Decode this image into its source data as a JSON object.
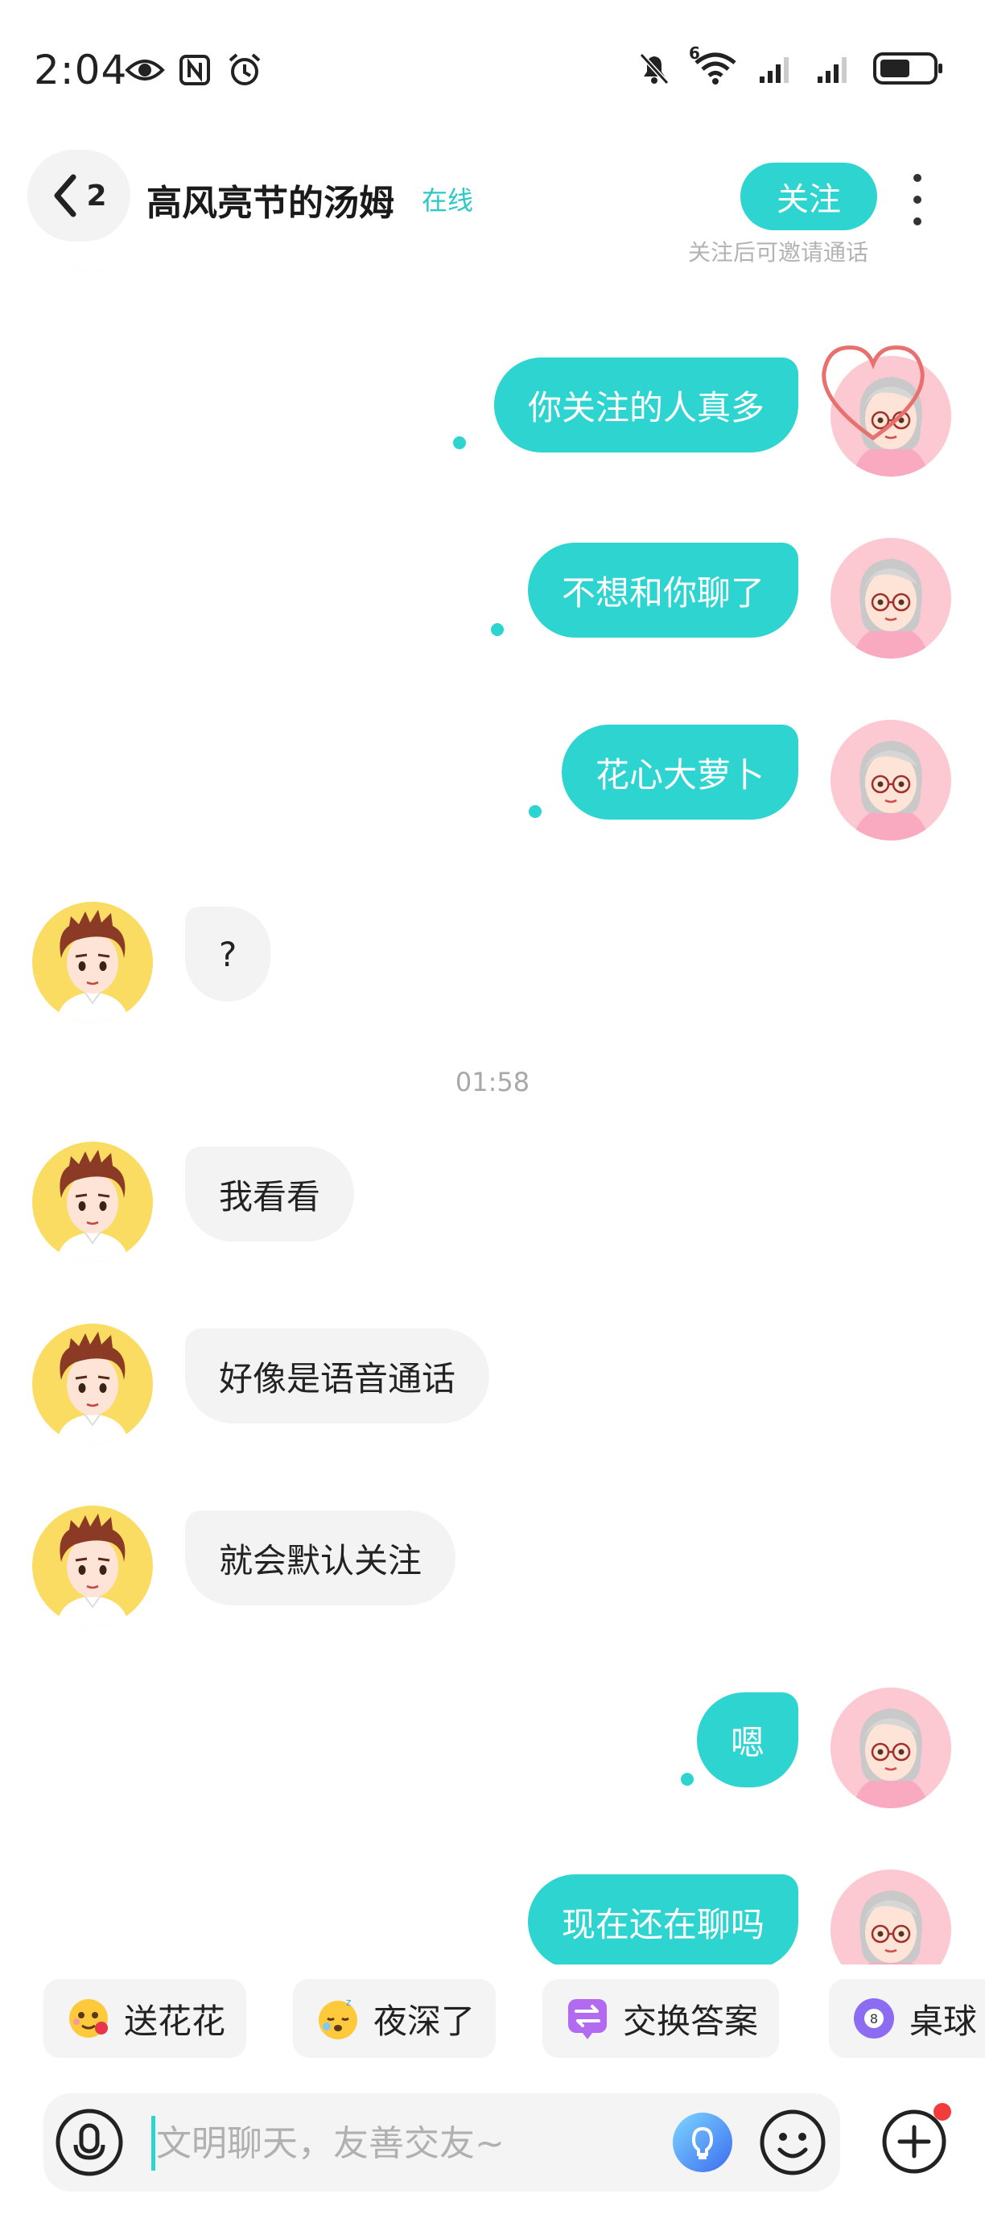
{
  "status_bar": {
    "time": "2:04",
    "left_icons": [
      "eye-icon",
      "nfc-icon",
      "alarm-icon"
    ],
    "right_icons": [
      "mute-bell-icon",
      "wifi-6-icon",
      "signal-1-icon",
      "signal-2-icon",
      "battery-icon"
    ],
    "wifi_label": "6"
  },
  "header": {
    "back_count": "2",
    "contact_name": "高风亮节的汤姆",
    "online_status": "在线",
    "follow_label": "关注",
    "follow_hint": "关注后可邀请通话"
  },
  "messages": [
    {
      "side": "out",
      "text": "你关注的人真多"
    },
    {
      "side": "out",
      "text": "不想和你聊了"
    },
    {
      "side": "out",
      "text": "花心大萝卜"
    },
    {
      "side": "in",
      "text": "?"
    },
    {
      "side": "in",
      "text": "我看看"
    },
    {
      "side": "in",
      "text": "好像是语音通话"
    },
    {
      "side": "in",
      "text": "就会默认关注"
    },
    {
      "side": "out",
      "text": "嗯"
    },
    {
      "side": "out",
      "text": "现在还在聊吗"
    }
  ],
  "timestamp": "01:58",
  "quick_replies": [
    {
      "label": "送花花",
      "icon": "flower-emoji-icon"
    },
    {
      "label": "夜深了",
      "icon": "sleepy-emoji-icon"
    },
    {
      "label": "交换答案",
      "icon": "exchange-icon"
    },
    {
      "label": "桌球",
      "icon": "billiard-ball-icon"
    }
  ],
  "input": {
    "placeholder": "文明聊天，友善交友~"
  },
  "colors": {
    "accent": "#2dd4d0",
    "bubble_in": "#f3f3f3",
    "avatar_me_bg": "#fcc8d2",
    "avatar_other_bg": "#fbdc63",
    "badge": "#f23b3b"
  }
}
